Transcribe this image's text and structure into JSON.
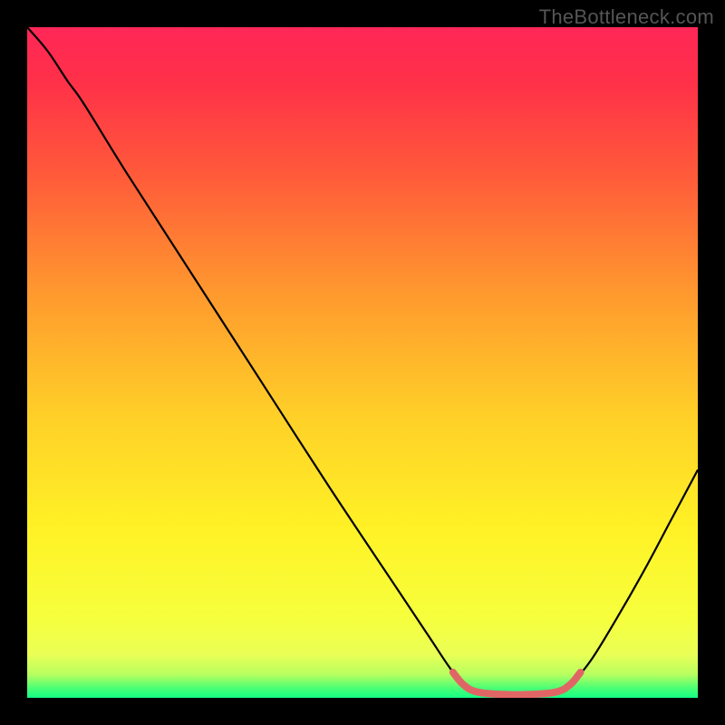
{
  "watermark": "TheBottleneck.com",
  "chart_data": {
    "type": "line",
    "title": "",
    "xlabel": "",
    "ylabel": "",
    "xlim": [
      0,
      100
    ],
    "ylim": [
      0,
      100
    ],
    "gradient_stops": [
      {
        "offset": 0.0,
        "color": "#ff2757"
      },
      {
        "offset": 0.08,
        "color": "#ff3049"
      },
      {
        "offset": 0.22,
        "color": "#ff5a3a"
      },
      {
        "offset": 0.4,
        "color": "#ff9a2e"
      },
      {
        "offset": 0.58,
        "color": "#ffd028"
      },
      {
        "offset": 0.75,
        "color": "#fff226"
      },
      {
        "offset": 0.88,
        "color": "#f6ff3d"
      },
      {
        "offset": 0.935,
        "color": "#eaff55"
      },
      {
        "offset": 0.965,
        "color": "#b8ff60"
      },
      {
        "offset": 0.985,
        "color": "#4dff74"
      },
      {
        "offset": 1.0,
        "color": "#13ff85"
      }
    ],
    "series": [
      {
        "name": "bottleneck-curve",
        "color": "#000000",
        "points": [
          {
            "x": 0.0,
            "y": 100.0
          },
          {
            "x": 3.0,
            "y": 96.5
          },
          {
            "x": 6.0,
            "y": 92.0
          },
          {
            "x": 8.5,
            "y": 88.5
          },
          {
            "x": 15.0,
            "y": 78.0
          },
          {
            "x": 25.0,
            "y": 62.5
          },
          {
            "x": 35.0,
            "y": 47.0
          },
          {
            "x": 45.0,
            "y": 31.5
          },
          {
            "x": 55.0,
            "y": 16.5
          },
          {
            "x": 60.0,
            "y": 9.0
          },
          {
            "x": 63.0,
            "y": 4.5
          },
          {
            "x": 65.0,
            "y": 2.0
          },
          {
            "x": 67.0,
            "y": 0.8
          },
          {
            "x": 71.0,
            "y": 0.3
          },
          {
            "x": 75.0,
            "y": 0.3
          },
          {
            "x": 79.0,
            "y": 0.8
          },
          {
            "x": 81.0,
            "y": 2.0
          },
          {
            "x": 84.0,
            "y": 5.5
          },
          {
            "x": 88.0,
            "y": 12.0
          },
          {
            "x": 92.0,
            "y": 19.0
          },
          {
            "x": 96.0,
            "y": 26.5
          },
          {
            "x": 100.0,
            "y": 34.0
          }
        ]
      },
      {
        "name": "optimal-range-marker",
        "color": "#e06666",
        "points": [
          {
            "x": 63.5,
            "y": 3.8
          },
          {
            "x": 65.0,
            "y": 2.0
          },
          {
            "x": 67.0,
            "y": 0.9
          },
          {
            "x": 71.0,
            "y": 0.5
          },
          {
            "x": 75.0,
            "y": 0.5
          },
          {
            "x": 79.0,
            "y": 0.9
          },
          {
            "x": 81.0,
            "y": 2.0
          },
          {
            "x": 82.5,
            "y": 3.8
          }
        ]
      }
    ]
  }
}
